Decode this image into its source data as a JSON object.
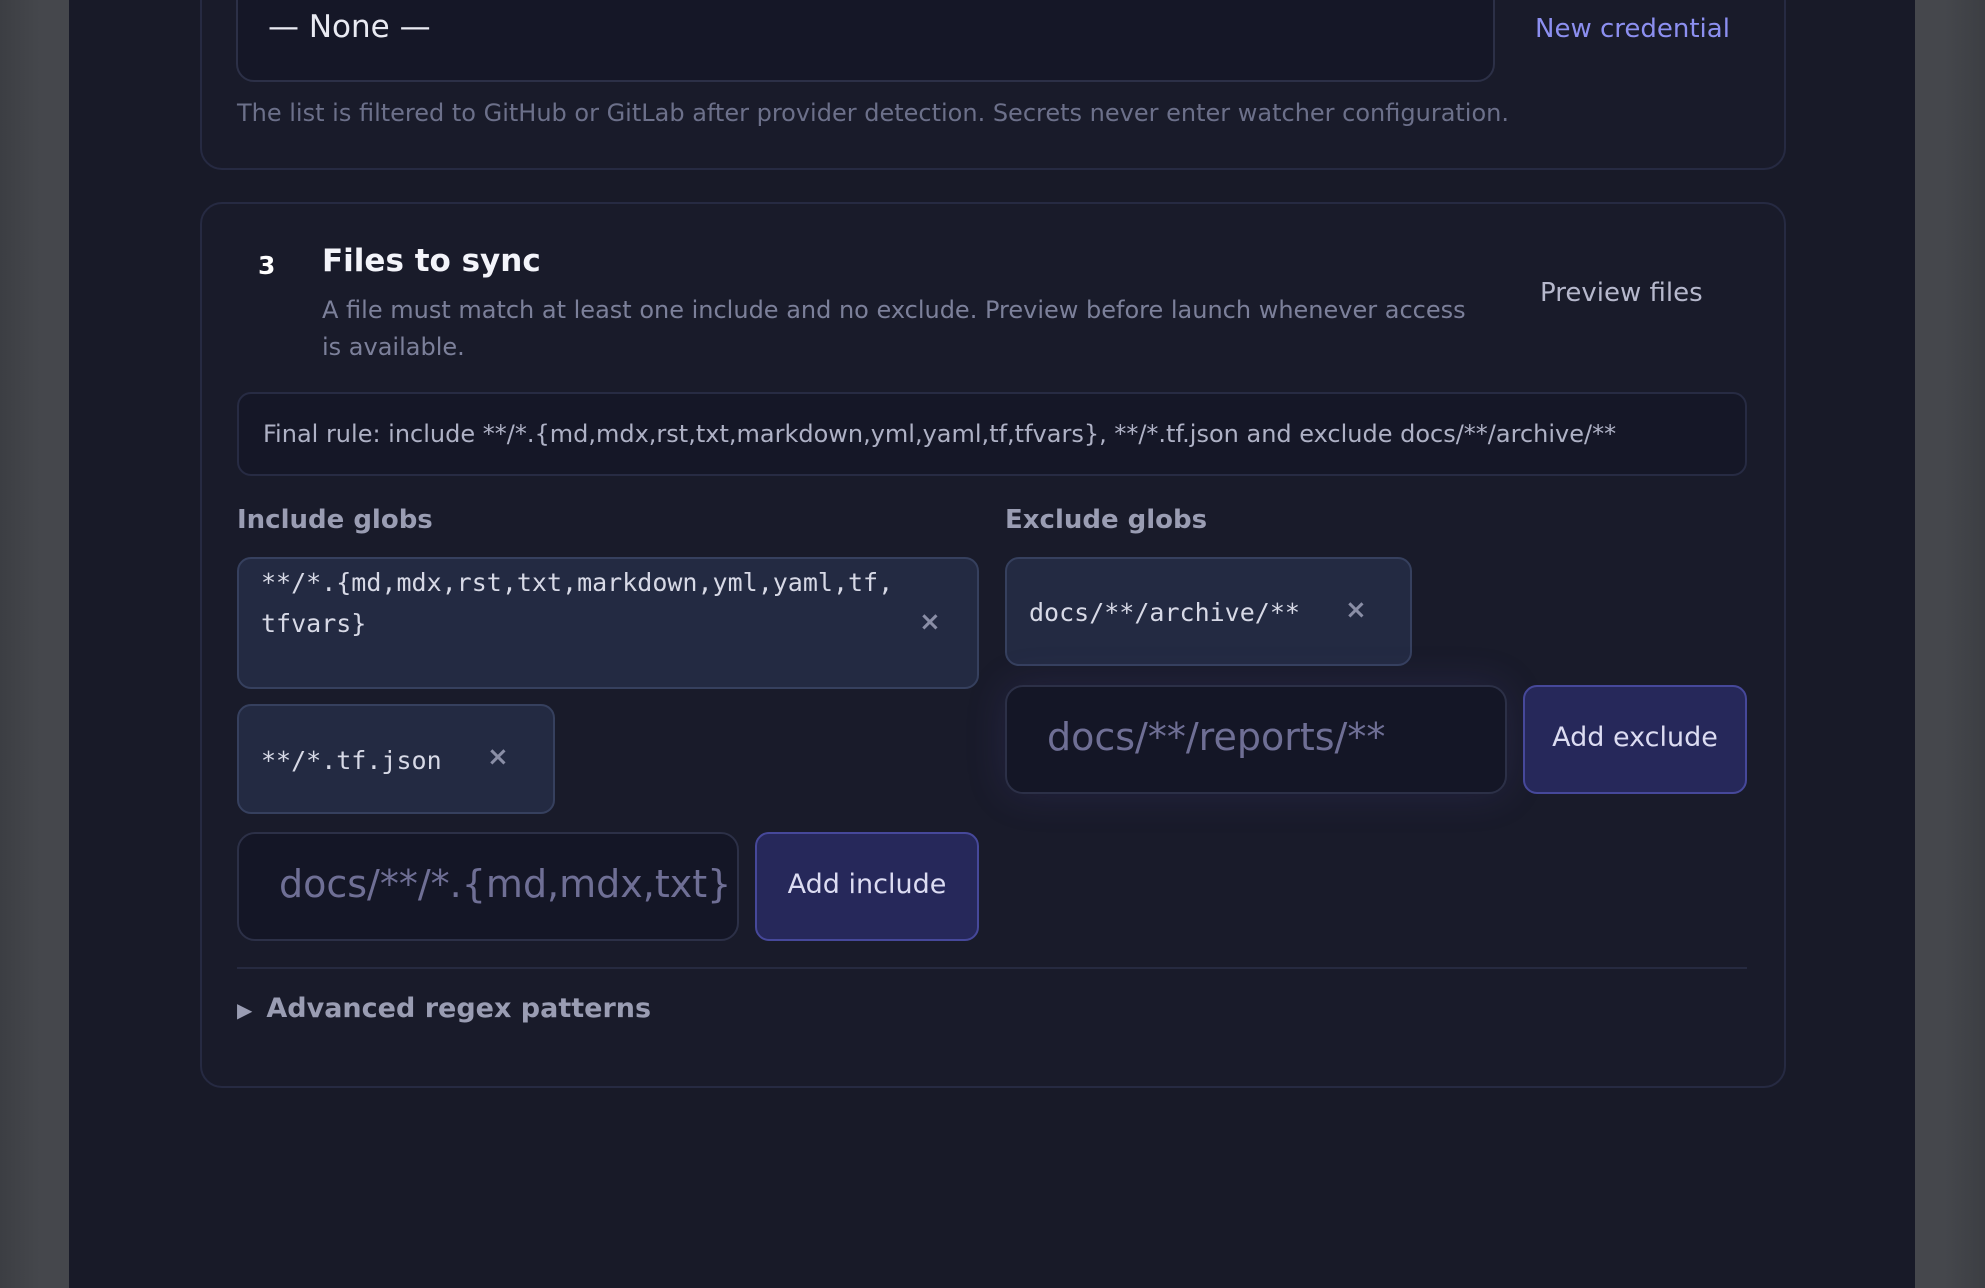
{
  "credential": {
    "selected": "— None —",
    "new_credential_label": "New credential",
    "helper": "The list is filtered to GitHub or GitLab after provider detection. Secrets never enter watcher configuration."
  },
  "files_section": {
    "step_number": "3",
    "title": "Files to sync",
    "description": "A file must match at least one include and no exclude. Preview before launch whenever access is available.",
    "preview_label": "Preview files",
    "final_rule": "Final rule: include **/*.{md,mdx,rst,txt,markdown,yml,yaml,tf,tfvars}, **/*.tf.json and exclude docs/**/archive/**",
    "include": {
      "label": "Include globs",
      "items": [
        "**/*.{md,mdx,rst,txt,markdown,yml,yaml,tf,tfvars}",
        "**/*.tf.json"
      ],
      "input_placeholder": "docs/**/*.{md,mdx,txt}",
      "add_label": "Add include"
    },
    "exclude": {
      "label": "Exclude globs",
      "items": [
        "docs/**/archive/**"
      ],
      "input_placeholder": "docs/**/reports/**",
      "add_label": "Add exclude"
    },
    "remove_glyph": "×",
    "advanced_label": "Advanced regex patterns",
    "advanced_glyph": "▶"
  }
}
